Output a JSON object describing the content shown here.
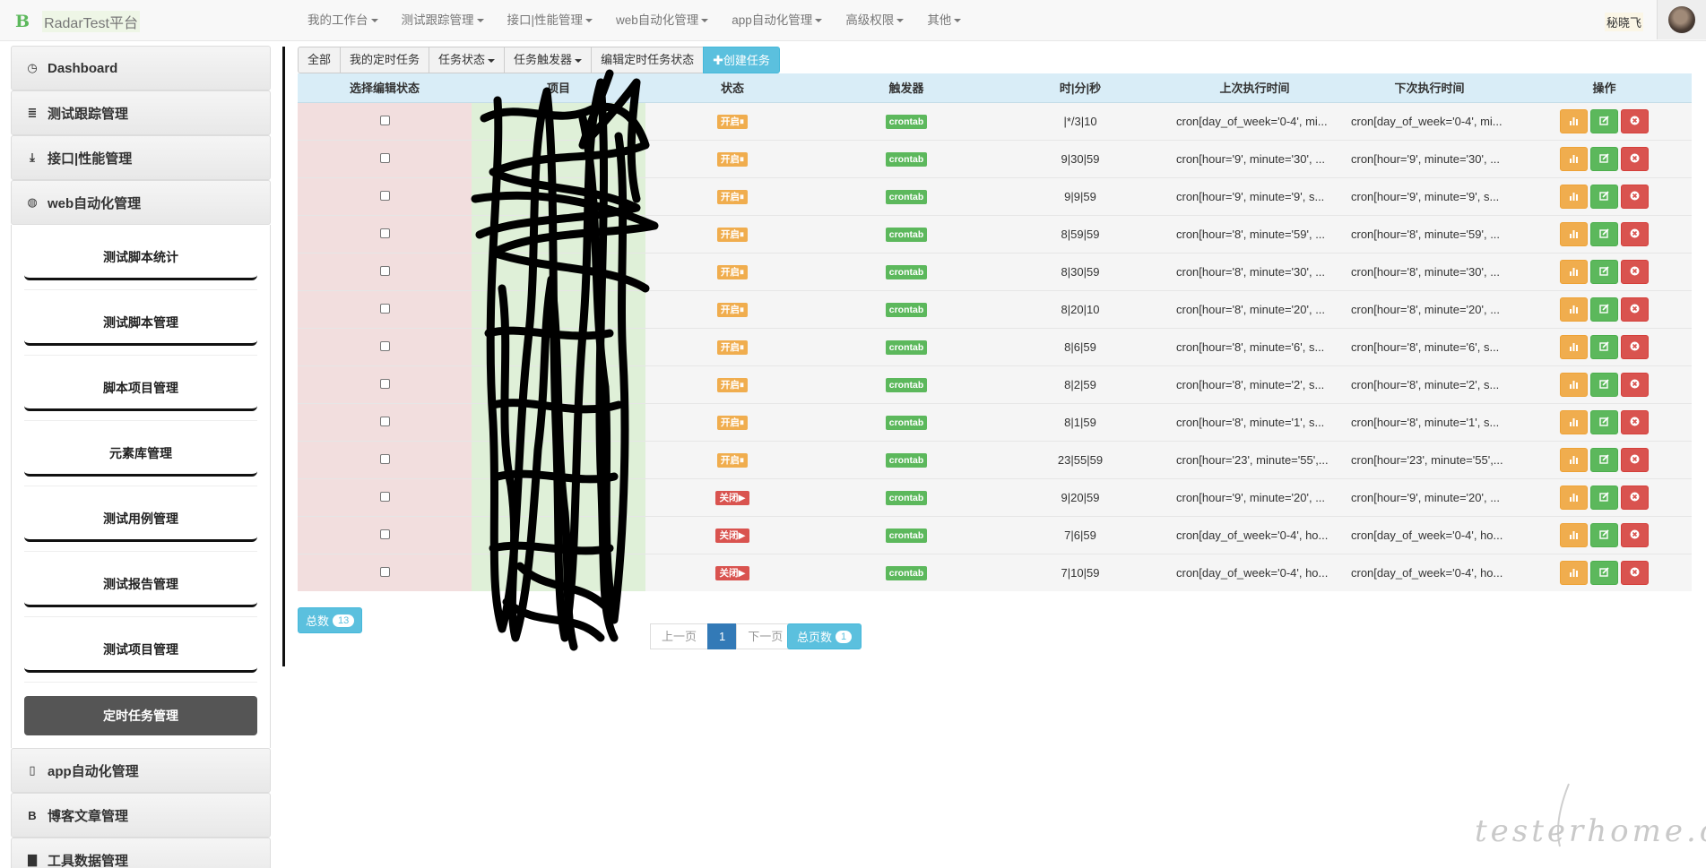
{
  "navbar": {
    "brand_letter": "B",
    "brand_name": "RadarTest平台",
    "menu": [
      "我的工作台",
      "测试跟踪管理",
      "接口|性能管理",
      "web自动化管理",
      "app自动化管理",
      "高级权限",
      "其他"
    ],
    "user": "秘晓飞"
  },
  "sidebar": {
    "items": [
      {
        "icon": "dashboard-icon",
        "glyph": "◷",
        "label": "Dashboard"
      },
      {
        "icon": "list-icon",
        "glyph": "≣",
        "label": "测试跟踪管理"
      },
      {
        "icon": "download-icon",
        "glyph": "⤓",
        "label": "接口|性能管理"
      },
      {
        "icon": "globe-icon",
        "glyph": "◍",
        "label": "web自动化管理"
      }
    ],
    "sub_items": [
      "测试脚本统计",
      "测试脚本管理",
      "脚本项目管理",
      "元素库管理",
      "测试用例管理",
      "测试报告管理",
      "测试项目管理"
    ],
    "active_sub": "定时任务管理",
    "items_after": [
      {
        "icon": "phone-icon",
        "glyph": "▯",
        "label": "app自动化管理"
      },
      {
        "icon": "blog-icon",
        "glyph": "B",
        "label": "博客文章管理"
      },
      {
        "icon": "briefcase-icon",
        "glyph": "▇",
        "label": "工具数据管理"
      }
    ]
  },
  "toolbar": {
    "all": "全部",
    "mine": "我的定时任务",
    "status": "任务状态",
    "trigger": "任务触发器",
    "edit_status": "编辑定时任务状态",
    "create": "创建任务",
    "create_plus": "✚"
  },
  "table": {
    "headers": [
      "选择编辑状态",
      "项目",
      "状态",
      "触发器",
      "时|分|秒",
      "上次执行时间",
      "下次执行时间",
      "操作"
    ],
    "rows": [
      {
        "status": "开启⏸",
        "on": true,
        "trigger": "crontab",
        "time": "|*/3|10",
        "last": "cron[day_of_week='0-4', mi...",
        "next": "cron[day_of_week='0-4', mi..."
      },
      {
        "status": "开启⏸",
        "on": true,
        "trigger": "crontab",
        "time": "9|30|59",
        "last": "cron[hour='9', minute='30', ...",
        "next": "cron[hour='9', minute='30', ..."
      },
      {
        "status": "开启⏸",
        "on": true,
        "trigger": "crontab",
        "time": "9|9|59",
        "last": "cron[hour='9', minute='9', s...",
        "next": "cron[hour='9', minute='9', s..."
      },
      {
        "status": "开启⏸",
        "on": true,
        "trigger": "crontab",
        "time": "8|59|59",
        "last": "cron[hour='8', minute='59', ...",
        "next": "cron[hour='8', minute='59', ..."
      },
      {
        "status": "开启⏸",
        "on": true,
        "trigger": "crontab",
        "time": "8|30|59",
        "last": "cron[hour='8', minute='30', ...",
        "next": "cron[hour='8', minute='30', ..."
      },
      {
        "status": "开启⏸",
        "on": true,
        "trigger": "crontab",
        "time": "8|20|10",
        "last": "cron[hour='8', minute='20', ...",
        "next": "cron[hour='8', minute='20', ..."
      },
      {
        "status": "开启⏸",
        "on": true,
        "trigger": "crontab",
        "time": "8|6|59",
        "last": "cron[hour='8', minute='6', s...",
        "next": "cron[hour='8', minute='6', s..."
      },
      {
        "status": "开启⏸",
        "on": true,
        "trigger": "crontab",
        "time": "8|2|59",
        "last": "cron[hour='8', minute='2', s...",
        "next": "cron[hour='8', minute='2', s..."
      },
      {
        "status": "开启⏸",
        "on": true,
        "trigger": "crontab",
        "time": "8|1|59",
        "last": "cron[hour='8', minute='1', s...",
        "next": "cron[hour='8', minute='1', s..."
      },
      {
        "status": "开启⏸",
        "on": true,
        "trigger": "crontab",
        "time": "23|55|59",
        "last": "cron[hour='23', minute='55',...",
        "next": "cron[hour='23', minute='55',..."
      },
      {
        "status": "关闭▶",
        "on": false,
        "trigger": "crontab",
        "time": "9|20|59",
        "last": "cron[hour='9', minute='20', ...",
        "next": "cron[hour='9', minute='20', ..."
      },
      {
        "status": "关闭▶",
        "on": false,
        "trigger": "crontab",
        "time": "7|6|59",
        "last": "cron[day_of_week='0-4', ho...",
        "next": "cron[day_of_week='0-4', ho..."
      },
      {
        "status": "关闭▶",
        "on": false,
        "trigger": "crontab",
        "time": "7|10|59",
        "last": "cron[day_of_week='0-4', ho...",
        "next": "cron[day_of_week='0-4', ho..."
      }
    ]
  },
  "footer": {
    "total_label": "总数",
    "total_count": "13",
    "prev": "上一页",
    "current_page": "1",
    "next": "下一页",
    "pages_label": "总页数",
    "pages_count": "1"
  },
  "watermark": "testerhome.com",
  "colors": {
    "header_bg": "#d9edf7",
    "check_col_bg": "#f2dede",
    "project_col_bg": "#dff0d8",
    "warning": "#f0ad4e",
    "danger": "#d9534f",
    "success": "#5cb85c",
    "info": "#5bc0de",
    "primary": "#337ab7"
  }
}
